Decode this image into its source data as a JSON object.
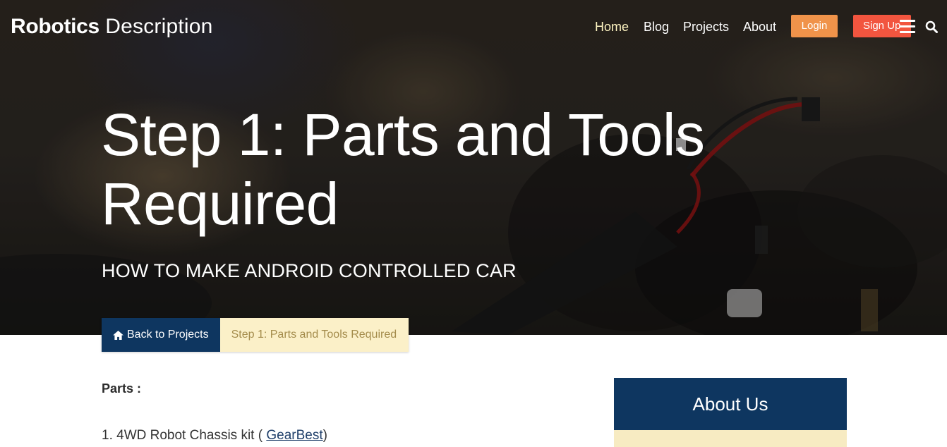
{
  "brand": {
    "bold": "Robotics",
    "light": "Description"
  },
  "nav": {
    "links": [
      "Home",
      "Blog",
      "Projects",
      "About"
    ],
    "login_label": "Login",
    "signup_label": "Sign Up",
    "menu_icon": "hamburger-menu-icon",
    "search_icon": "search-icon"
  },
  "hero": {
    "title": "Step 1: Parts and Tools Required",
    "subtitle": "HOW TO MAKE ANDROID CONTROLLED CAR"
  },
  "breadcrumb": {
    "back_icon": "home-icon",
    "back_label": "Back to Projects",
    "current_label": "Step 1: Parts and Tools Required"
  },
  "content": {
    "parts_heading": "Parts :",
    "item_1_prefix": "1. 4WD Robot Chassis kit ( ",
    "item_1_link": "GearBest",
    "item_1_suffix": ")"
  },
  "sidebar": {
    "about_title": "About Us"
  },
  "colors": {
    "navy": "#0e3660",
    "cream": "#fbf0c8",
    "login": "#f0934a",
    "signup": "#f2553f",
    "active_nav": "#fff5c2"
  }
}
